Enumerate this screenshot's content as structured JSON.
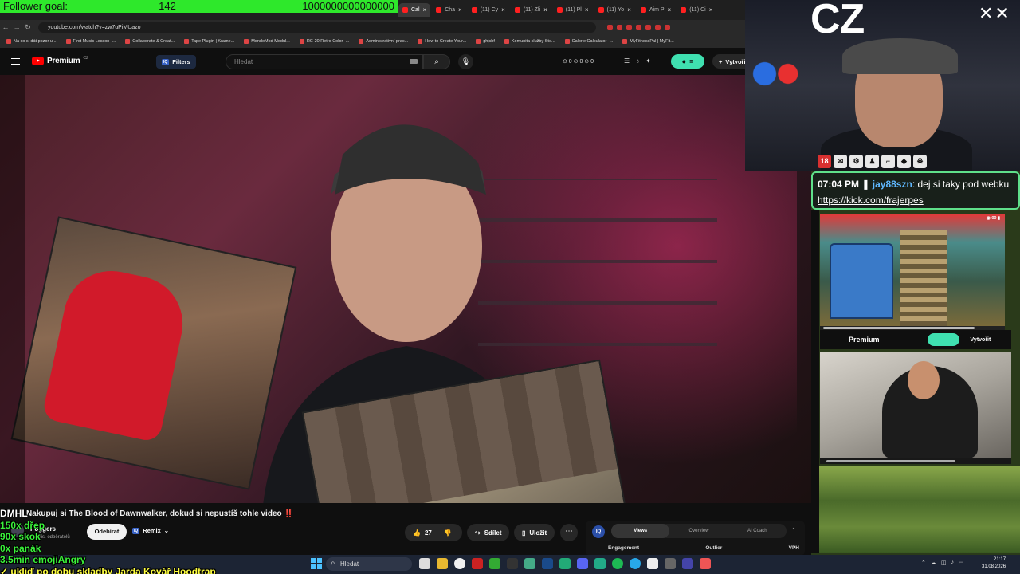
{
  "goal": {
    "label": "Follower goal:",
    "current": "142",
    "target": "1000000000000000"
  },
  "browser": {
    "tabs": [
      {
        "label": "Cal",
        "active": true
      },
      {
        "label": "Cha",
        "active": false
      },
      {
        "label": "(11) Cy",
        "active": false
      },
      {
        "label": "(11) Zli",
        "active": false
      },
      {
        "label": "(11) Pl",
        "active": false
      },
      {
        "label": "(11) Yo",
        "active": false
      },
      {
        "label": "Aim P",
        "active": false
      },
      {
        "label": "(11) Ci",
        "active": false
      }
    ],
    "url": "youtube.com/watch?v=zw7uPiMUazo",
    "bookmarks": [
      "Na co si dát pozor u...",
      "First Music Lesson -...",
      "Collaborate & Creat...",
      "Tape Plugin | Krame...",
      "MondoMod Modul...",
      "RC-20 Retro Color -...",
      "Administrativní prac...",
      "How to Create Your...",
      "ghjshf",
      "Komunita služby Ste...",
      "Calorie Calculator -...",
      "MyFitnessPal | MyFit..."
    ]
  },
  "youtube": {
    "brand": "Premium",
    "region": "CZ",
    "filters_label": "Filters",
    "search_placeholder": "Hledat",
    "stats": "⊙ 0  ⊙ 0  ⊙ 0",
    "create_label": "Vytvořit",
    "video_title": "Nakupuj si The Blood of Dawnwalker, dokud si nepustíš tohle video ‼️",
    "channel_name": "Poggers",
    "channel_subs": "tis. odběratelů",
    "subscribe_label": "Odebírat",
    "remix_label": "Remix",
    "like_count": "27",
    "share_label": "Sdílet",
    "save_label": "Uložit",
    "vq_tabs": [
      "Views",
      "Overview",
      "AI Coach"
    ],
    "vq_columns": [
      "Engagement",
      "Outlier",
      "VPH"
    ]
  },
  "stream": {
    "logo": "CZ",
    "chat": {
      "time": "07:04 PM",
      "user": "jay88szn",
      "text_a": ": dej si taky pod webku ",
      "link": "https://kick.com/frajerpes"
    },
    "badge_18": "18"
  },
  "overlay": {
    "top": "DMHL",
    "lines": [
      "150x dřep",
      "90x skok",
      "0x panák",
      "3.5min emojiAngry"
    ],
    "last": "✓ ukliď po dobu skladby Jarda Kovář Hoodtrap"
  },
  "taskbar": {
    "search": "Hledat",
    "time": "21:17",
    "date": "31.08.2026"
  },
  "colors": {
    "goal": "#2ee82b",
    "youtube_red": "#ff0000",
    "chat_border": "#5fe08a",
    "overlay_text": "#3af23a"
  }
}
